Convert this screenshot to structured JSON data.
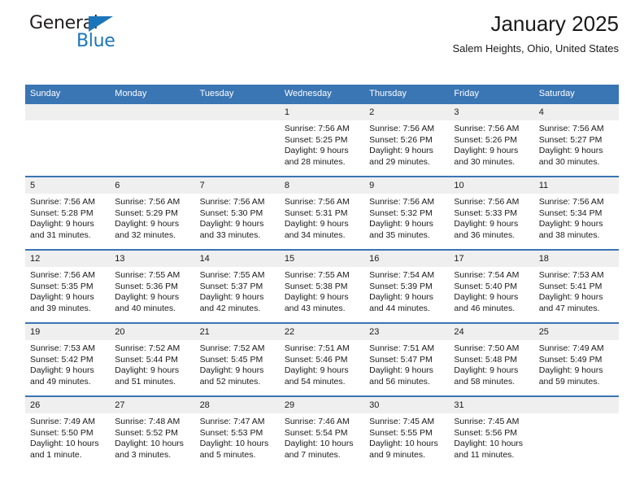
{
  "brand": {
    "name_top": "General",
    "name_bottom": "Blue"
  },
  "header": {
    "title": "January 2025",
    "location": "Salem Heights, Ohio, United States"
  },
  "colors": {
    "header_blue": "#3a75b4",
    "daynum_gray": "#efeff0",
    "brand_blue": "#1b75bb",
    "text": "#1a1a1a"
  },
  "weekdays": [
    "Sunday",
    "Monday",
    "Tuesday",
    "Wednesday",
    "Thursday",
    "Friday",
    "Saturday"
  ],
  "weeks": [
    [
      {
        "day": "",
        "empty": true
      },
      {
        "day": "",
        "empty": true
      },
      {
        "day": "",
        "empty": true
      },
      {
        "day": "1",
        "sunrise": "Sunrise: 7:56 AM",
        "sunset": "Sunset: 5:25 PM",
        "daylight_1": "Daylight: 9 hours",
        "daylight_2": "and 28 minutes."
      },
      {
        "day": "2",
        "sunrise": "Sunrise: 7:56 AM",
        "sunset": "Sunset: 5:26 PM",
        "daylight_1": "Daylight: 9 hours",
        "daylight_2": "and 29 minutes."
      },
      {
        "day": "3",
        "sunrise": "Sunrise: 7:56 AM",
        "sunset": "Sunset: 5:26 PM",
        "daylight_1": "Daylight: 9 hours",
        "daylight_2": "and 30 minutes."
      },
      {
        "day": "4",
        "sunrise": "Sunrise: 7:56 AM",
        "sunset": "Sunset: 5:27 PM",
        "daylight_1": "Daylight: 9 hours",
        "daylight_2": "and 30 minutes."
      }
    ],
    [
      {
        "day": "5",
        "sunrise": "Sunrise: 7:56 AM",
        "sunset": "Sunset: 5:28 PM",
        "daylight_1": "Daylight: 9 hours",
        "daylight_2": "and 31 minutes."
      },
      {
        "day": "6",
        "sunrise": "Sunrise: 7:56 AM",
        "sunset": "Sunset: 5:29 PM",
        "daylight_1": "Daylight: 9 hours",
        "daylight_2": "and 32 minutes."
      },
      {
        "day": "7",
        "sunrise": "Sunrise: 7:56 AM",
        "sunset": "Sunset: 5:30 PM",
        "daylight_1": "Daylight: 9 hours",
        "daylight_2": "and 33 minutes."
      },
      {
        "day": "8",
        "sunrise": "Sunrise: 7:56 AM",
        "sunset": "Sunset: 5:31 PM",
        "daylight_1": "Daylight: 9 hours",
        "daylight_2": "and 34 minutes."
      },
      {
        "day": "9",
        "sunrise": "Sunrise: 7:56 AM",
        "sunset": "Sunset: 5:32 PM",
        "daylight_1": "Daylight: 9 hours",
        "daylight_2": "and 35 minutes."
      },
      {
        "day": "10",
        "sunrise": "Sunrise: 7:56 AM",
        "sunset": "Sunset: 5:33 PM",
        "daylight_1": "Daylight: 9 hours",
        "daylight_2": "and 36 minutes."
      },
      {
        "day": "11",
        "sunrise": "Sunrise: 7:56 AM",
        "sunset": "Sunset: 5:34 PM",
        "daylight_1": "Daylight: 9 hours",
        "daylight_2": "and 38 minutes."
      }
    ],
    [
      {
        "day": "12",
        "sunrise": "Sunrise: 7:56 AM",
        "sunset": "Sunset: 5:35 PM",
        "daylight_1": "Daylight: 9 hours",
        "daylight_2": "and 39 minutes."
      },
      {
        "day": "13",
        "sunrise": "Sunrise: 7:55 AM",
        "sunset": "Sunset: 5:36 PM",
        "daylight_1": "Daylight: 9 hours",
        "daylight_2": "and 40 minutes."
      },
      {
        "day": "14",
        "sunrise": "Sunrise: 7:55 AM",
        "sunset": "Sunset: 5:37 PM",
        "daylight_1": "Daylight: 9 hours",
        "daylight_2": "and 42 minutes."
      },
      {
        "day": "15",
        "sunrise": "Sunrise: 7:55 AM",
        "sunset": "Sunset: 5:38 PM",
        "daylight_1": "Daylight: 9 hours",
        "daylight_2": "and 43 minutes."
      },
      {
        "day": "16",
        "sunrise": "Sunrise: 7:54 AM",
        "sunset": "Sunset: 5:39 PM",
        "daylight_1": "Daylight: 9 hours",
        "daylight_2": "and 44 minutes."
      },
      {
        "day": "17",
        "sunrise": "Sunrise: 7:54 AM",
        "sunset": "Sunset: 5:40 PM",
        "daylight_1": "Daylight: 9 hours",
        "daylight_2": "and 46 minutes."
      },
      {
        "day": "18",
        "sunrise": "Sunrise: 7:53 AM",
        "sunset": "Sunset: 5:41 PM",
        "daylight_1": "Daylight: 9 hours",
        "daylight_2": "and 47 minutes."
      }
    ],
    [
      {
        "day": "19",
        "sunrise": "Sunrise: 7:53 AM",
        "sunset": "Sunset: 5:42 PM",
        "daylight_1": "Daylight: 9 hours",
        "daylight_2": "and 49 minutes."
      },
      {
        "day": "20",
        "sunrise": "Sunrise: 7:52 AM",
        "sunset": "Sunset: 5:44 PM",
        "daylight_1": "Daylight: 9 hours",
        "daylight_2": "and 51 minutes."
      },
      {
        "day": "21",
        "sunrise": "Sunrise: 7:52 AM",
        "sunset": "Sunset: 5:45 PM",
        "daylight_1": "Daylight: 9 hours",
        "daylight_2": "and 52 minutes."
      },
      {
        "day": "22",
        "sunrise": "Sunrise: 7:51 AM",
        "sunset": "Sunset: 5:46 PM",
        "daylight_1": "Daylight: 9 hours",
        "daylight_2": "and 54 minutes."
      },
      {
        "day": "23",
        "sunrise": "Sunrise: 7:51 AM",
        "sunset": "Sunset: 5:47 PM",
        "daylight_1": "Daylight: 9 hours",
        "daylight_2": "and 56 minutes."
      },
      {
        "day": "24",
        "sunrise": "Sunrise: 7:50 AM",
        "sunset": "Sunset: 5:48 PM",
        "daylight_1": "Daylight: 9 hours",
        "daylight_2": "and 58 minutes."
      },
      {
        "day": "25",
        "sunrise": "Sunrise: 7:49 AM",
        "sunset": "Sunset: 5:49 PM",
        "daylight_1": "Daylight: 9 hours",
        "daylight_2": "and 59 minutes."
      }
    ],
    [
      {
        "day": "26",
        "sunrise": "Sunrise: 7:49 AM",
        "sunset": "Sunset: 5:50 PM",
        "daylight_1": "Daylight: 10 hours",
        "daylight_2": "and 1 minute."
      },
      {
        "day": "27",
        "sunrise": "Sunrise: 7:48 AM",
        "sunset": "Sunset: 5:52 PM",
        "daylight_1": "Daylight: 10 hours",
        "daylight_2": "and 3 minutes."
      },
      {
        "day": "28",
        "sunrise": "Sunrise: 7:47 AM",
        "sunset": "Sunset: 5:53 PM",
        "daylight_1": "Daylight: 10 hours",
        "daylight_2": "and 5 minutes."
      },
      {
        "day": "29",
        "sunrise": "Sunrise: 7:46 AM",
        "sunset": "Sunset: 5:54 PM",
        "daylight_1": "Daylight: 10 hours",
        "daylight_2": "and 7 minutes."
      },
      {
        "day": "30",
        "sunrise": "Sunrise: 7:45 AM",
        "sunset": "Sunset: 5:55 PM",
        "daylight_1": "Daylight: 10 hours",
        "daylight_2": "and 9 minutes."
      },
      {
        "day": "31",
        "sunrise": "Sunrise: 7:45 AM",
        "sunset": "Sunset: 5:56 PM",
        "daylight_1": "Daylight: 10 hours",
        "daylight_2": "and 11 minutes."
      },
      {
        "day": "",
        "empty": true
      }
    ]
  ]
}
